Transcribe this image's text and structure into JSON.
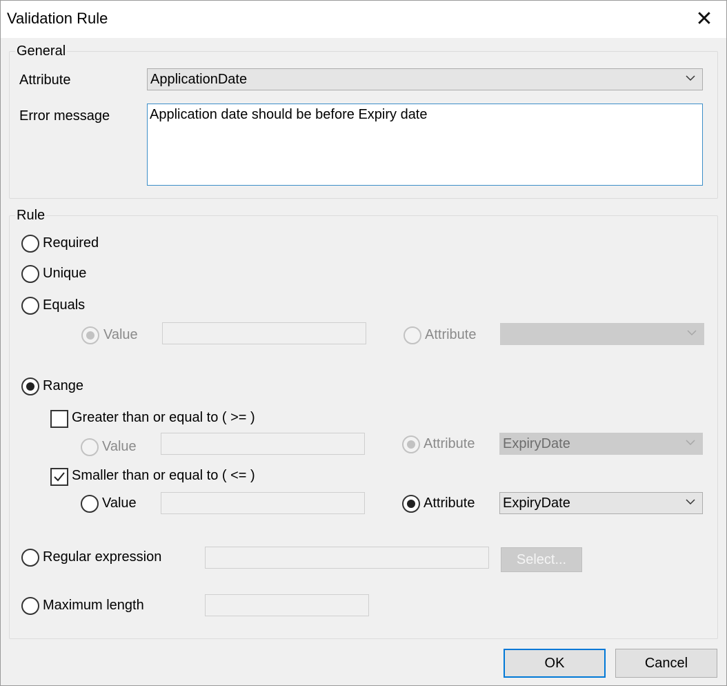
{
  "window": {
    "title": "Validation Rule",
    "close_glyph": "✕"
  },
  "general": {
    "group_label": "General",
    "attribute_label": "Attribute",
    "attribute_value": "ApplicationDate",
    "error_label": "Error message",
    "error_value": "Application date should be before Expiry date"
  },
  "rule": {
    "group_label": "Rule",
    "required_label": "Required",
    "unique_label": "Unique",
    "equals": {
      "label": "Equals",
      "value_label": "Value",
      "value_input": "",
      "attribute_label": "Attribute",
      "attribute_value": ""
    },
    "range": {
      "label": "Range",
      "gte": {
        "label": "Greater than or equal to ( >= )",
        "checked": false,
        "value_label": "Value",
        "value_input": "",
        "attribute_label": "Attribute",
        "attribute_value": "ExpiryDate"
      },
      "lte": {
        "label": "Smaller than or equal to  ( <= )",
        "checked": true,
        "value_label": "Value",
        "value_input": "",
        "attribute_label": "Attribute",
        "attribute_value": "ExpiryDate"
      }
    },
    "regex": {
      "label": "Regular expression",
      "value": "",
      "select_button": "Select..."
    },
    "maxlen": {
      "label": "Maximum length",
      "value": ""
    },
    "selected": "Range"
  },
  "buttons": {
    "ok": "OK",
    "cancel": "Cancel"
  },
  "colors": {
    "accent": "#0078d7",
    "window_bg": "#f0f0f0",
    "titlebar_bg": "#ffffff"
  }
}
